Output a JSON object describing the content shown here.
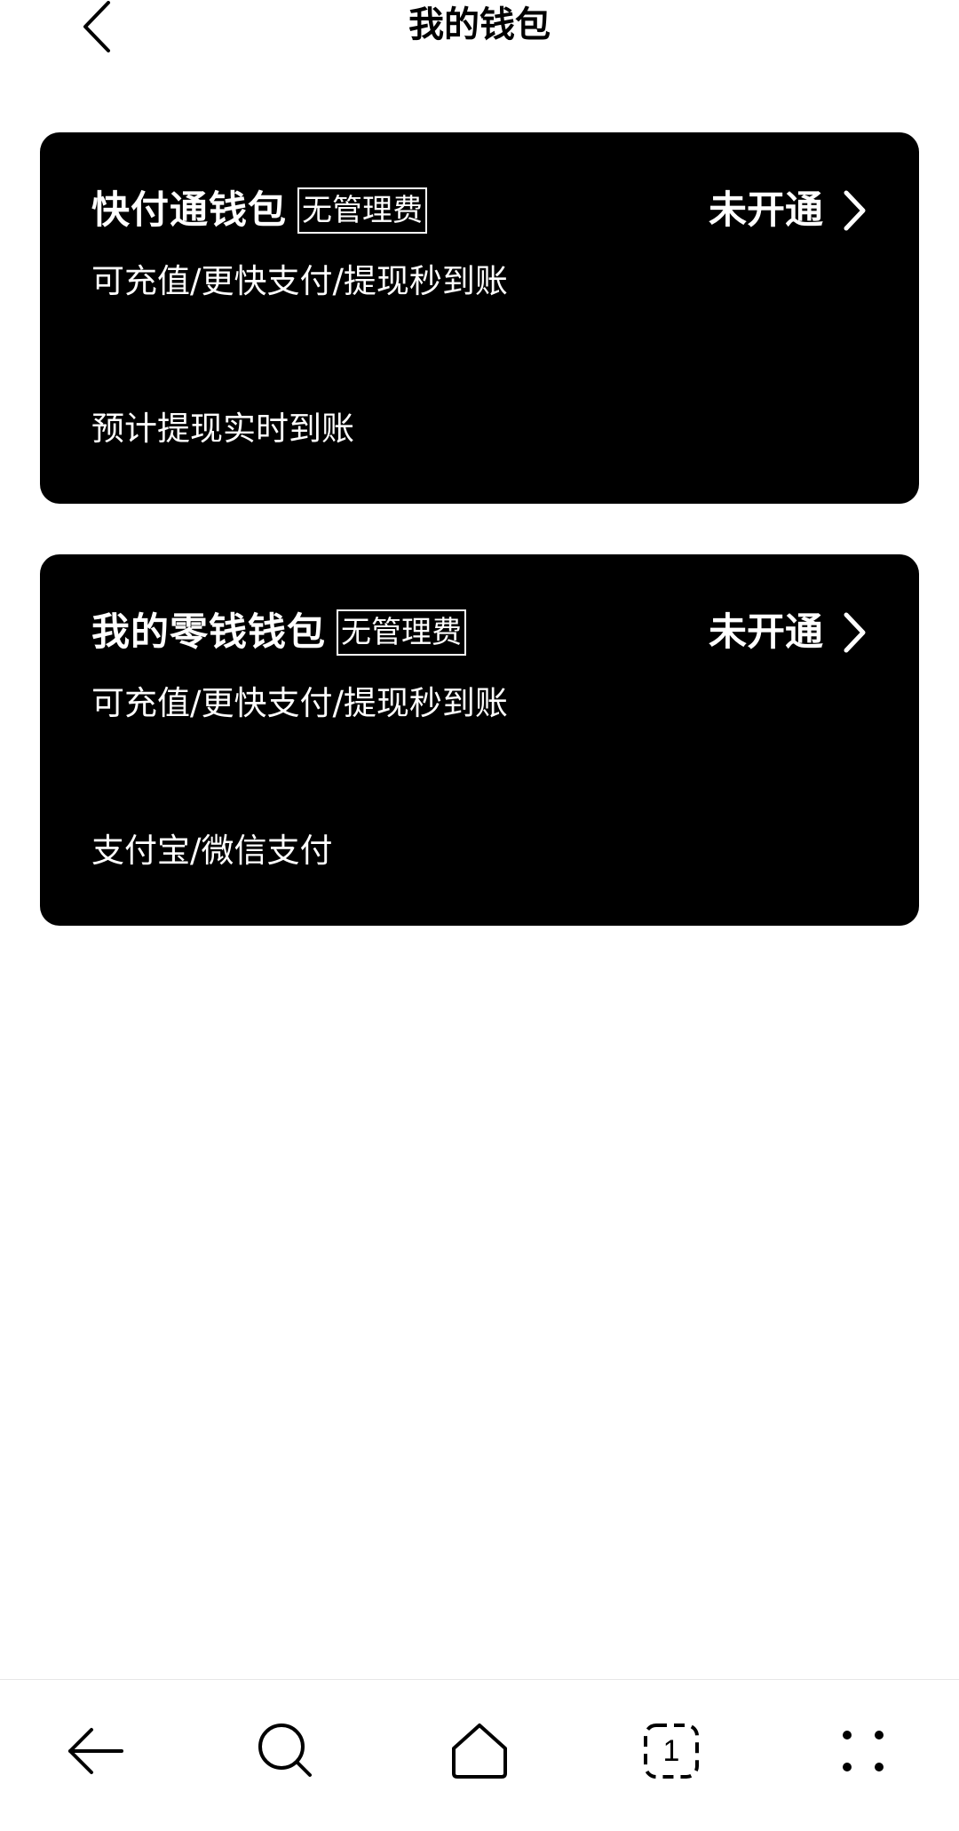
{
  "header": {
    "title": "我的钱包",
    "back_icon": "chevron-left-icon"
  },
  "cards": [
    {
      "title": "快付通钱包",
      "tag": "无管理费",
      "status": "未开通",
      "description": "可充值/更快支付/提现秒到账",
      "footnote": "预计提现实时到账"
    },
    {
      "title": "我的零钱钱包",
      "tag": "无管理费",
      "status": "未开通",
      "description": "可充值/更快支付/提现秒到账",
      "footnote": "支付宝/微信支付"
    }
  ],
  "bottom_nav": {
    "items": [
      "back-arrow-icon",
      "search-icon",
      "home-icon",
      "tabs-icon",
      "more-icon"
    ],
    "tabs_count": "1"
  },
  "colors": {
    "card_background": "#000000",
    "card_text": "#ffffff",
    "page_background": "#ffffff"
  }
}
